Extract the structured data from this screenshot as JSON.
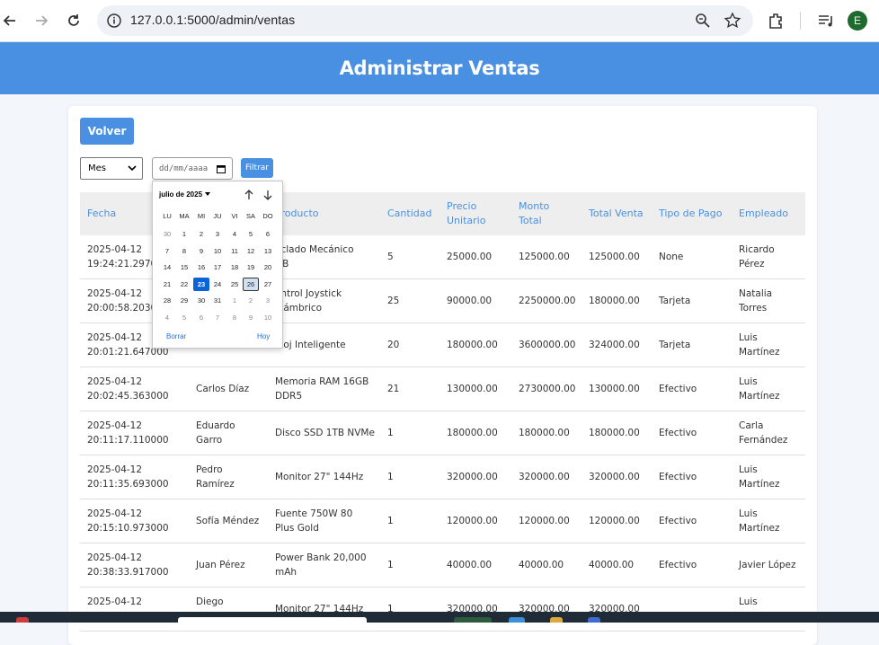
{
  "browser": {
    "url": "127.0.0.1:5000/admin/ventas",
    "profile_initial": "E"
  },
  "header": {
    "title": "Administrar Ventas"
  },
  "controls": {
    "back_label": "Volver",
    "period_select_value": "Mes",
    "date_placeholder": "dd/mm/aaaa",
    "filter_label": "Filtrar"
  },
  "table": {
    "headers": [
      "Fecha",
      "Cliente",
      "Producto",
      "Cantidad",
      "Precio Unitario",
      "Monto Total",
      "Total Venta",
      "Tipo de Pago",
      "Empleado"
    ],
    "header_lines": {
      "fecha": "Fecha",
      "producto_visible": "Producto",
      "cantidad": "Cantidad",
      "precio_1": "Precio",
      "precio_2": "Unitario",
      "monto_1": "Monto",
      "monto_2": "Total",
      "total_venta": "Total Venta",
      "tipo_pago": "Tipo de Pago",
      "empleado": "Empleado"
    },
    "rows": [
      {
        "fecha_1": "2025-04-12",
        "fecha_2": "19:24:21.29700",
        "cliente_1": "",
        "cliente_2": "",
        "producto_1": "eclado Mecánico",
        "producto_2": "GB",
        "cantidad": "5",
        "precio": "25000.00",
        "monto": "125000.00",
        "total": "125000.00",
        "pago": "None",
        "empleado_1": "Ricardo",
        "empleado_2": "Pérez"
      },
      {
        "fecha_1": "2025-04-12",
        "fecha_2": "20:00:58.2030",
        "cliente_1": "",
        "cliente_2": "",
        "producto_1": "ontrol Joystick",
        "producto_2": "alámbrico",
        "cantidad": "25",
        "precio": "90000.00",
        "monto": "2250000.00",
        "total": "180000.00",
        "pago": "Tarjeta",
        "empleado_1": "Natalia",
        "empleado_2": "Torres"
      },
      {
        "fecha_1": "2025-04-12",
        "fecha_2": "20:01:21.647000",
        "cliente_1": "",
        "cliente_2": "",
        "producto_1": "eloj Inteligente",
        "producto_2": "",
        "cantidad": "20",
        "precio": "180000.00",
        "monto": "3600000.00",
        "total": "324000.00",
        "pago": "Tarjeta",
        "empleado_1": "Luis",
        "empleado_2": "Martínez"
      },
      {
        "fecha_1": "2025-04-12",
        "fecha_2": "20:02:45.363000",
        "cliente_1": "Carlos Díaz",
        "cliente_2": "",
        "producto_1": "Memoria RAM 16GB",
        "producto_2": "DDR5",
        "cantidad": "21",
        "precio": "130000.00",
        "monto": "2730000.00",
        "total": "130000.00",
        "pago": "Efectivo",
        "empleado_1": "Luis",
        "empleado_2": "Martínez"
      },
      {
        "fecha_1": "2025-04-12",
        "fecha_2": "20:11:17.110000",
        "cliente_1": "Eduardo",
        "cliente_2": "Garro",
        "producto_1": "Disco SSD 1TB NVMe",
        "producto_2": "",
        "cantidad": "1",
        "precio": "180000.00",
        "monto": "180000.00",
        "total": "180000.00",
        "pago": "Efectivo",
        "empleado_1": "Carla",
        "empleado_2": "Fernández"
      },
      {
        "fecha_1": "2025-04-12",
        "fecha_2": "20:11:35.693000",
        "cliente_1": "Pedro",
        "cliente_2": "Ramírez",
        "producto_1": "Monitor 27\" 144Hz",
        "producto_2": "",
        "cantidad": "1",
        "precio": "320000.00",
        "monto": "320000.00",
        "total": "320000.00",
        "pago": "Efectivo",
        "empleado_1": "Luis",
        "empleado_2": "Martínez"
      },
      {
        "fecha_1": "2025-04-12",
        "fecha_2": "20:15:10.973000",
        "cliente_1": "Sofía Méndez",
        "cliente_2": "",
        "producto_1": "Fuente 750W 80",
        "producto_2": "Plus Gold",
        "cantidad": "1",
        "precio": "120000.00",
        "monto": "120000.00",
        "total": "120000.00",
        "pago": "Efectivo",
        "empleado_1": "Luis",
        "empleado_2": "Martínez"
      },
      {
        "fecha_1": "2025-04-12",
        "fecha_2": "20:38:33.917000",
        "cliente_1": "Juan Pérez",
        "cliente_2": "",
        "producto_1": "Power Bank 20,000",
        "producto_2": "mAh",
        "cantidad": "1",
        "precio": "40000.00",
        "monto": "40000.00",
        "total": "40000.00",
        "pago": "Efectivo",
        "empleado_1": "Javier López",
        "empleado_2": ""
      },
      {
        "fecha_1": "2025-04-12",
        "fecha_2": "",
        "cliente_1": "Diego",
        "cliente_2": "",
        "producto_1": "Monitor 27\" 144Hz",
        "producto_2": "",
        "cantidad": "1",
        "precio": "320000.00",
        "monto": "320000.00",
        "total": "320000.00",
        "pago": "",
        "empleado_1": "Luis",
        "empleado_2": ""
      }
    ]
  },
  "datepicker": {
    "month_label": "julio de 2025",
    "weekdays": [
      "LU",
      "MA",
      "MI",
      "JU",
      "VI",
      "SA",
      "DO"
    ],
    "weeks": [
      [
        "30",
        "1",
        "2",
        "3",
        "4",
        "5",
        "6"
      ],
      [
        "7",
        "8",
        "9",
        "10",
        "11",
        "12",
        "13"
      ],
      [
        "14",
        "15",
        "16",
        "17",
        "18",
        "19",
        "20"
      ],
      [
        "21",
        "22",
        "23",
        "24",
        "25",
        "26",
        "27"
      ],
      [
        "28",
        "29",
        "30",
        "31",
        "1",
        "2",
        "3"
      ],
      [
        "4",
        "5",
        "6",
        "7",
        "8",
        "9",
        "10"
      ]
    ],
    "selected_day": "23",
    "today_day": "26",
    "clear_label": "Borrar",
    "today_label": "Hoy"
  },
  "colors": {
    "accent": "#4a90e2",
    "selected": "#0a64d8"
  }
}
